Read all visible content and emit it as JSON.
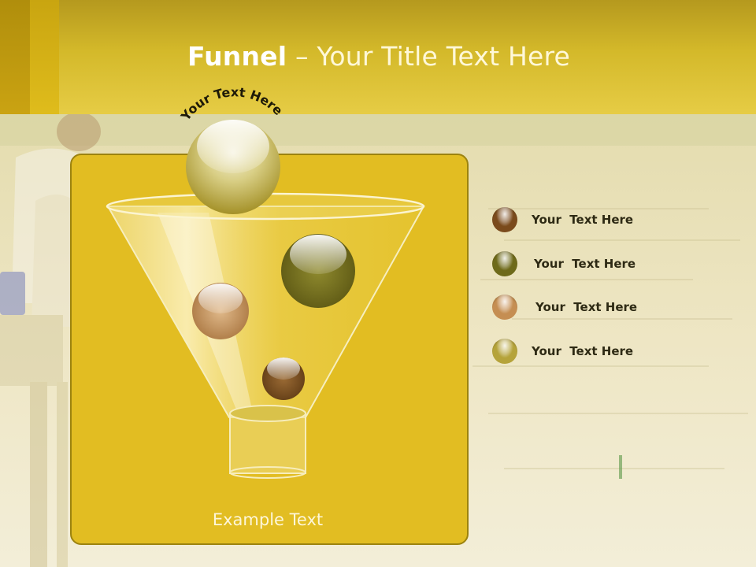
{
  "slide": {
    "title_bold": "Funnel",
    "title_sep": " – ",
    "title_rest": "Your Title Text Here",
    "arc_text": "Your Text Here",
    "panel_label": "Example Text"
  },
  "legend": [
    {
      "label": "Your  Text Here",
      "color": "#7a4a1c"
    },
    {
      "label": "Your  Text Here",
      "color": "#6e6a1a"
    },
    {
      "label": "Your  Text Here",
      "color": "#c58e52"
    },
    {
      "label": "Your  Text Here",
      "color": "#b5a33a"
    }
  ],
  "colors": {
    "header": "#d4b92a",
    "panel": "#e2bd22",
    "panel_border": "#9c830f"
  }
}
